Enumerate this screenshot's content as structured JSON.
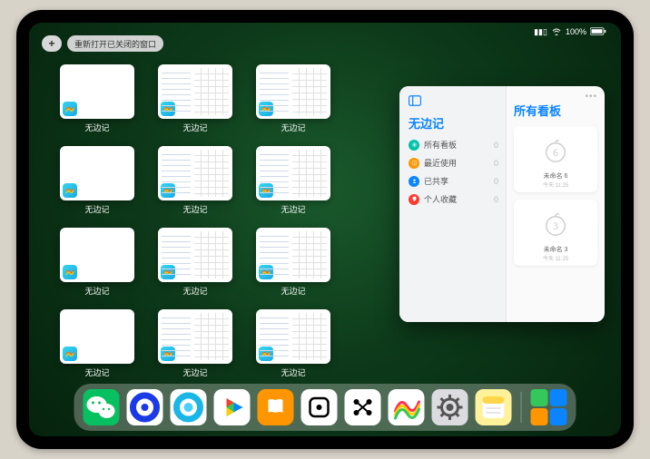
{
  "status": {
    "battery": "100%",
    "wifi": "wifi-icon",
    "signal": "signal-icon"
  },
  "toolbar": {
    "plus": "+",
    "reopen_label": "重新打开已关闭的窗口"
  },
  "app_name": "无边记",
  "tiles": [
    {
      "label": "无边记",
      "style": "blank"
    },
    {
      "label": "无边记",
      "style": "cal"
    },
    {
      "label": "无边记",
      "style": "cal"
    },
    {
      "label": "无边记",
      "style": "blank"
    },
    {
      "label": "无边记",
      "style": "cal"
    },
    {
      "label": "无边记",
      "style": "cal"
    },
    {
      "label": "无边记",
      "style": "blank"
    },
    {
      "label": "无边记",
      "style": "cal"
    },
    {
      "label": "无边记",
      "style": "cal"
    },
    {
      "label": "无边记",
      "style": "blank"
    },
    {
      "label": "无边记",
      "style": "cal"
    },
    {
      "label": "无边记",
      "style": "cal"
    }
  ],
  "panel": {
    "title": "无边记",
    "rows": [
      {
        "label": "所有看板",
        "count": "0",
        "color": "#00c2a8"
      },
      {
        "label": "最近使用",
        "count": "0",
        "color": "#ff9500"
      },
      {
        "label": "已共享",
        "count": "0",
        "color": "#0a84ff"
      },
      {
        "label": "个人收藏",
        "count": "0",
        "color": "#ff3b30"
      }
    ],
    "right_title": "所有看板",
    "boards": [
      {
        "name": "未命名 6",
        "time": "今天 11:25",
        "digit": "6"
      },
      {
        "name": "未命名 3",
        "time": "今天 11:25",
        "digit": "3"
      }
    ]
  },
  "dock": [
    {
      "name": "wechat",
      "bg": "#07c160",
      "glyph": "wechat"
    },
    {
      "name": "browser1",
      "bg": "#ffffff",
      "glyph": "ring-blue"
    },
    {
      "name": "browser2",
      "bg": "#ffffff",
      "glyph": "ring-cyan"
    },
    {
      "name": "play",
      "bg": "#ffffff",
      "glyph": "play"
    },
    {
      "name": "books",
      "bg": "#ff9500",
      "glyph": "books"
    },
    {
      "name": "dice",
      "bg": "#ffffff",
      "glyph": "dice"
    },
    {
      "name": "dots",
      "bg": "#ffffff",
      "glyph": "dots"
    },
    {
      "name": "freeform",
      "bg": "#ffffff",
      "glyph": "scribble"
    },
    {
      "name": "settings",
      "bg": "#dcdce0",
      "glyph": "gear"
    },
    {
      "name": "notes",
      "bg": "#fff29a",
      "glyph": "notes"
    }
  ]
}
